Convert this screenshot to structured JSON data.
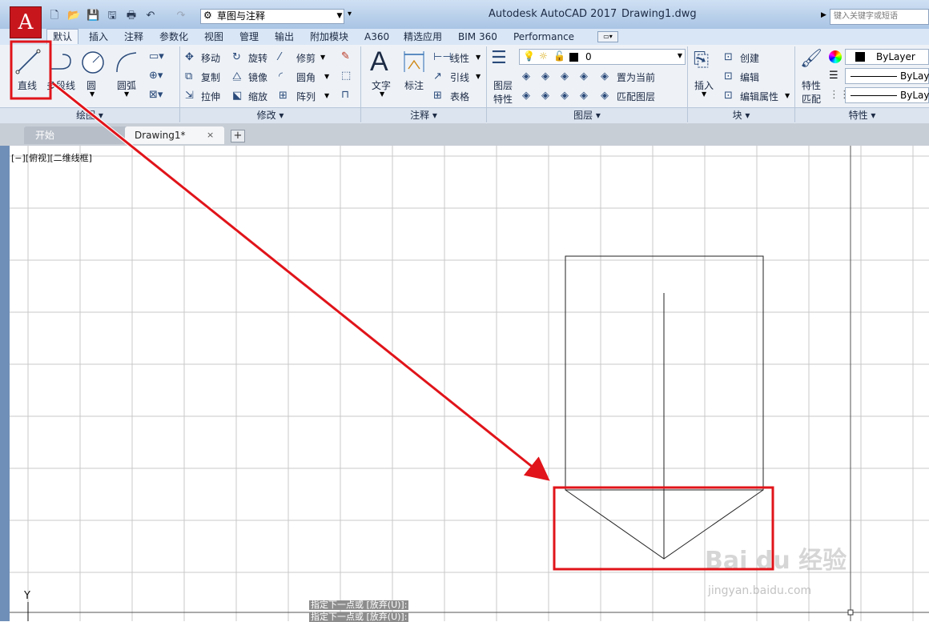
{
  "title": {
    "app": "Autodesk AutoCAD 2017",
    "file": "Drawing1.dwg",
    "workspace": "草图与注释",
    "search_placeholder": "键入关键字或短语",
    "app_button": "A"
  },
  "ribbon_tabs": [
    "默认",
    "插入",
    "注释",
    "参数化",
    "视图",
    "管理",
    "输出",
    "附加模块",
    "A360",
    "精选应用",
    "BIM 360",
    "Performance"
  ],
  "panels": {
    "draw": {
      "label": "绘图 ▾",
      "line": "直线",
      "polyline": "多段线",
      "circle": "圆",
      "arc": "圆弧"
    },
    "modify": {
      "label": "修改 ▾",
      "move": "移动",
      "rotate": "旋转",
      "trim": "修剪",
      "copy": "复制",
      "mirror": "镜像",
      "fillet": "圆角",
      "stretch": "拉伸",
      "scale": "缩放",
      "array": "阵列"
    },
    "annotation": {
      "label": "注释 ▾",
      "text": "文字",
      "dimension": "标注",
      "linear": "线性",
      "leader": "引线",
      "table": "表格"
    },
    "layers": {
      "label": "图层 ▾",
      "layer_props_1": "图层",
      "layer_props_2": "特性",
      "current_layer": "0",
      "set_current": "置为当前",
      "match_layer": "匹配图层"
    },
    "block": {
      "label": "块 ▾",
      "insert": "插入",
      "create": "创建",
      "edit": "编辑",
      "edit_attr": "编辑属性"
    },
    "properties": {
      "label": "特性 ▾",
      "match_1": "特性",
      "match_2": "匹配",
      "color": "ByLayer",
      "linetype": "ByLaye",
      "lineweight": "ByLaye"
    }
  },
  "doc_tabs": {
    "start": "开始",
    "drawing": "Drawing1*",
    "close": "×",
    "add": "+"
  },
  "viewport": {
    "label": "[−][俯视][二维线框]",
    "ucs_y": "Y"
  },
  "command_line": [
    "指定下一点或 [放弃(U)]:",
    "指定下一点或 [放弃(U)]:"
  ],
  "watermark": {
    "brand": "Bai du 经验",
    "url": "jingyan.baidu.com"
  },
  "colors": {
    "highlight_red": "#e0141a",
    "accent_blue": "#2a4a7a",
    "autocad_red": "#c8161d"
  }
}
